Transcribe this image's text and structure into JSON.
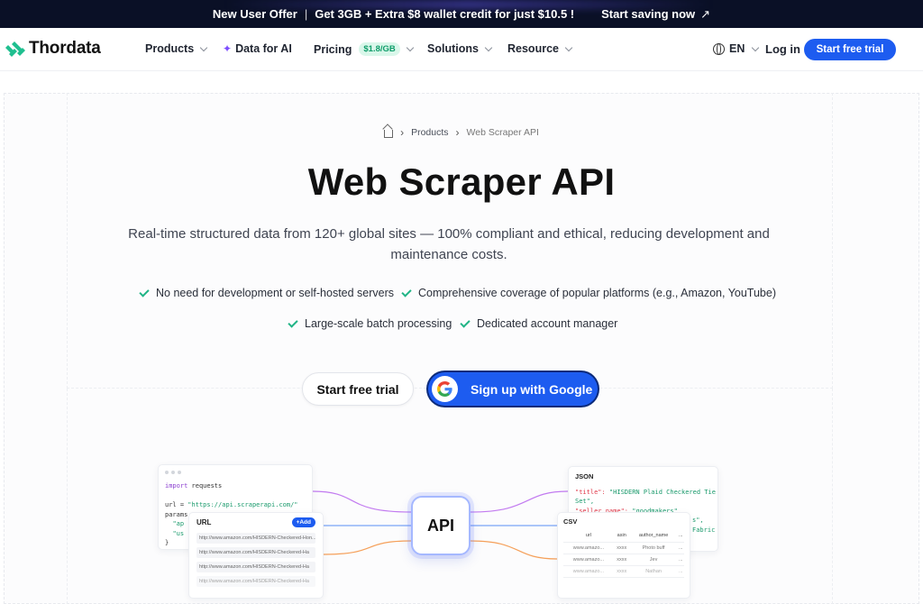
{
  "announcement": {
    "label": "New User Offer",
    "offer": "Get 3GB + Extra $8 wallet credit for just $10.5 !",
    "cta": "Start saving now"
  },
  "nav": {
    "brand": "Thordata",
    "items": [
      {
        "label": "Products"
      },
      {
        "label": "Data for AI"
      },
      {
        "label": "Pricing",
        "badge": "$1.8/GB"
      },
      {
        "label": "Solutions"
      },
      {
        "label": "Resource"
      }
    ],
    "language": "EN",
    "login": "Log in",
    "cta": "Start free trial"
  },
  "breadcrumb": {
    "items": [
      "Products",
      "Web Scraper API"
    ]
  },
  "hero": {
    "title": "Web Scraper API",
    "subtitle": "Real-time structured data from 120+ global sites — 100% compliant and ethical, reducing development and maintenance costs.",
    "features": [
      "No need for development or self-hosted servers",
      "Comprehensive coverage of popular platforms (e.g., Amazon, YouTube)",
      "Large-scale batch processing",
      "Dedicated account manager"
    ],
    "trial_button": "Start free trial",
    "google_button": "Sign up with Google"
  },
  "illustration": {
    "code_lines": [
      "import requests",
      "url = \"https://api.scraperapi.com/\"",
      "params",
      "\"ap",
      "\"us",
      "}"
    ],
    "url_title": "URL",
    "url_add": "+Add",
    "urls": [
      "http://www.amazon.com/HISDERN-Checkered-Hon...",
      "http://www.amazon.com/HISDERN-Checkered-Ha",
      "http://www.amazon.com/HISDERN-Checkered-Ha",
      "http://www.amazon.com/HISDERN-Checkered-Ha"
    ],
    "api_label": "API",
    "json_title": "JSON",
    "json_lines": [
      {
        "key": "\"title\":",
        "val": " \"HISDERN Plaid Checkered Tie"
      },
      {
        "key": "",
        "val": "Set\","
      },
      {
        "key": "\"seller_name\":",
        "val": " \"goodmakers\""
      },
      {
        "key": "",
        "val": "s\","
      },
      {
        "key": "",
        "val": "Fabric"
      }
    ],
    "csv_title": "CSV",
    "csv_headers": [
      "url",
      "asin",
      "author_name",
      "..."
    ],
    "csv_rows": [
      [
        "www.amazo...",
        "xxxx",
        "Photo buff",
        "..."
      ],
      [
        "www.amazo...",
        "xxxx",
        "Jev",
        "..."
      ],
      [
        "www.amazo...",
        "xxxx",
        "Nathan",
        "..."
      ]
    ]
  },
  "colors": {
    "brand_blue": "#1d5cf0",
    "brand_green": "#20b486",
    "topbar_bg": "#0a1026"
  }
}
